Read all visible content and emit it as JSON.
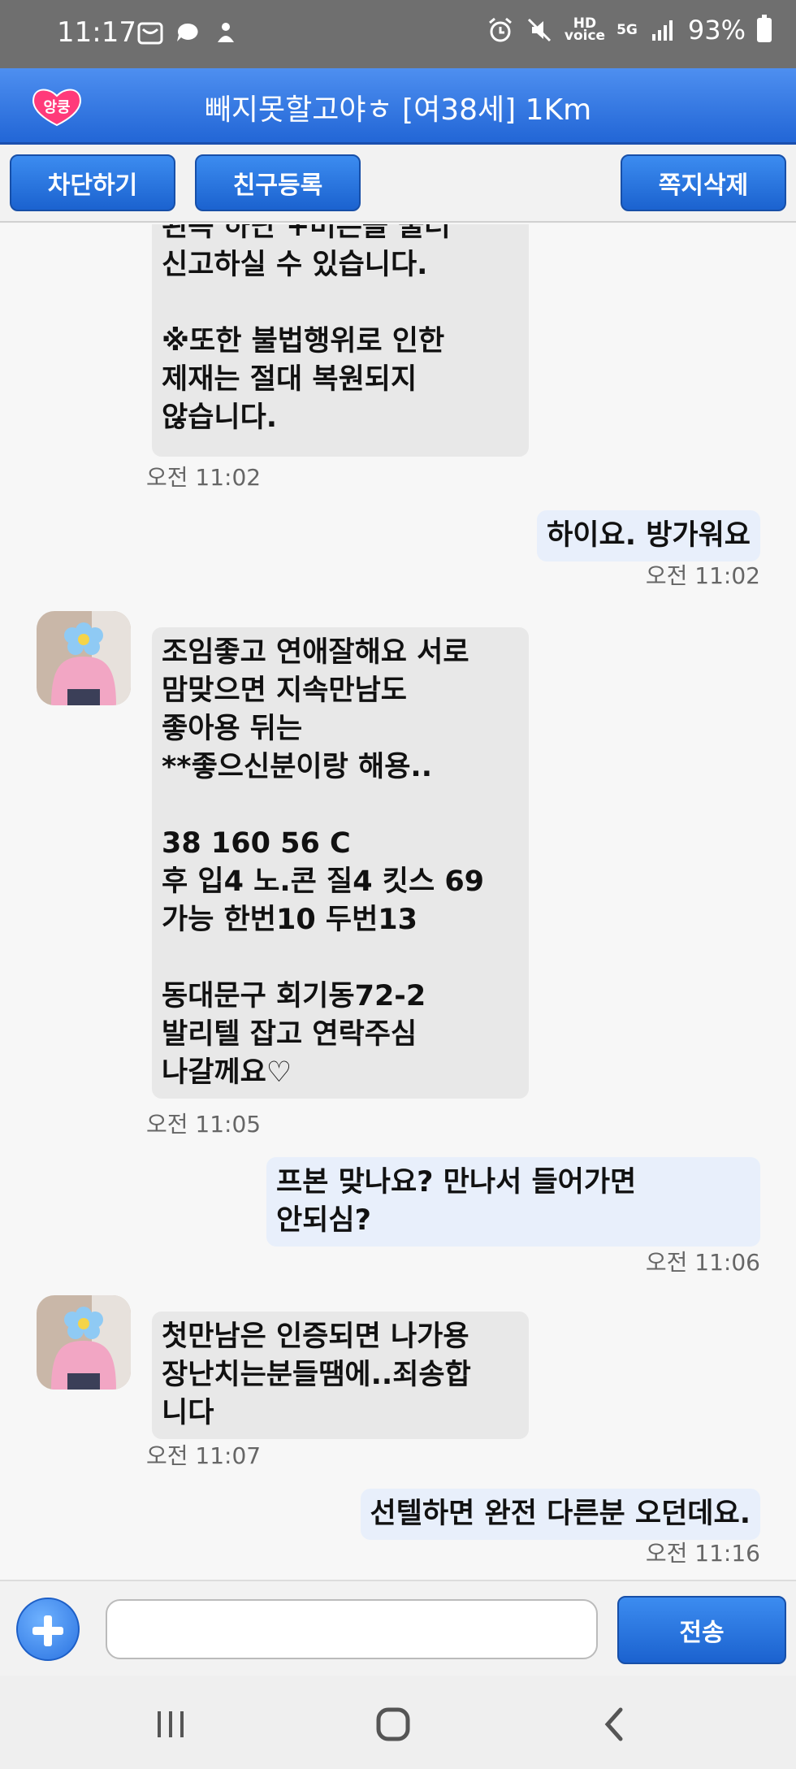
{
  "status_bar": {
    "time": "11:17",
    "network": "5G",
    "battery": "93%"
  },
  "header": {
    "logo_text": "앙쿵",
    "title": "빼지못할고야ㅎ [여38세] 1Km",
    "accent_color": "#2a72e0"
  },
  "actions": {
    "block": "차단하기",
    "add_friend": "친구등록",
    "delete_note": "쪽지삭제"
  },
  "messages": [
    {
      "from": "them",
      "text": "왼쪽 하단 +버튼을 눌러\n신고하실 수 있습니다.\n\n※또한 불법행위로 인한\n제재는 절대 복원되지\n않습니다.",
      "time": "오전 11:02"
    },
    {
      "from": "me",
      "text": "하이요. 방가워요",
      "time": "오전 11:02"
    },
    {
      "from": "them",
      "text": "조임좋고 연애잘해요 서로\n맘맞으면 지속만남도\n좋아용 뒤는\n**좋으신분이랑 해용..\n\n38 160 56 C\n후 입4 노.콘 질4 킷스 69\n가능 한번10 두번13\n\n동대문구 회기동72-2\n발리텔 잡고 연락주심\n나갈께요♡",
      "time": "오전 11:05"
    },
    {
      "from": "me",
      "text": "프본 맞나요? 만나서 들어가면\n안되심?",
      "time": "오전 11:06"
    },
    {
      "from": "them",
      "text": "첫만남은 인증되면 나가용\n장난치는분들땜에..죄송합\n니다",
      "time": "오전 11:07"
    },
    {
      "from": "me",
      "text": "선텔하면 완전 다른분 오던데요.",
      "time": "오전 11:16"
    }
  ],
  "composer": {
    "input_value": "",
    "send": "전송"
  }
}
